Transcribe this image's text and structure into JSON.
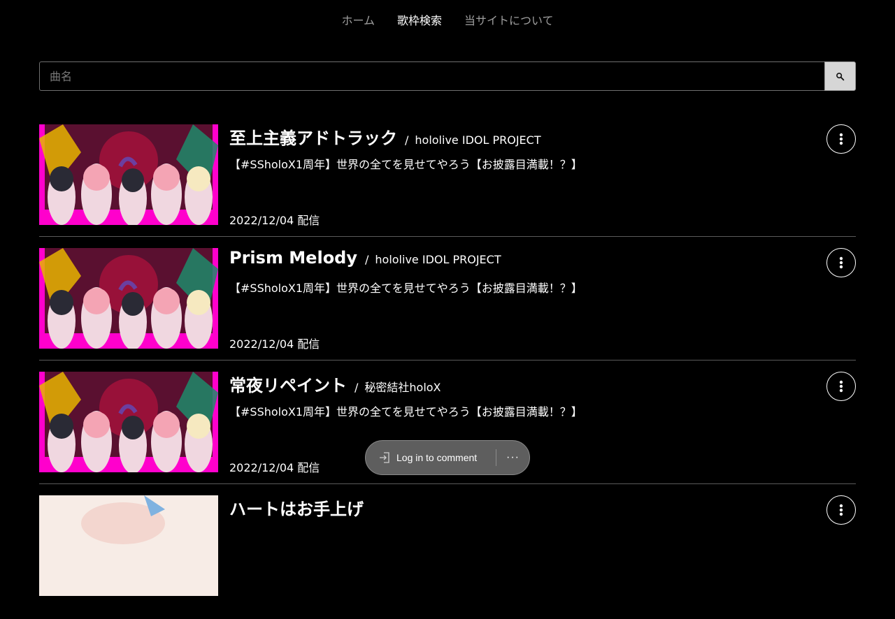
{
  "nav": {
    "items": [
      {
        "label": "ホーム",
        "active": false
      },
      {
        "label": "歌枠検索",
        "active": true
      },
      {
        "label": "当サイトについて",
        "active": false
      }
    ]
  },
  "search": {
    "placeholder": "曲名",
    "value": "",
    "button_icon": "search-icon"
  },
  "results": [
    {
      "title": "至上主義アドトラック",
      "separator": "/",
      "artist": "hololive IDOL PROJECT",
      "stream_title": "【#SSholoX1周年】世界の全てを見せてやろう【お披露目満載！？】",
      "date": "2022/12/04 配信",
      "menu_icon": "more-vert-icon"
    },
    {
      "title": "Prism Melody",
      "separator": "/",
      "artist": "hololive IDOL PROJECT",
      "stream_title": "【#SSholoX1周年】世界の全てを見せてやろう【お披露目満載！？】",
      "date": "2022/12/04 配信",
      "menu_icon": "more-vert-icon"
    },
    {
      "title": "常夜リペイント",
      "separator": "/",
      "artist": "秘密結社holoX",
      "stream_title": "【#SSholoX1周年】世界の全てを見せてやろう【お披露目満載！？】",
      "date": "2022/12/04 配信",
      "menu_icon": "more-vert-icon"
    },
    {
      "title": "ハートはお手上げ",
      "separator": "",
      "artist": "",
      "stream_title": "",
      "date": "",
      "menu_icon": "more-vert-icon"
    }
  ],
  "comment_bar": {
    "login_label": "Log in to comment",
    "more_label": "···",
    "login_icon": "login-icon"
  },
  "colors": {
    "background": "#000000",
    "nav_inactive": "#9e9e9e",
    "thumb_magenta": "#ff00cc",
    "pill_bg": "#5e5e5e"
  }
}
